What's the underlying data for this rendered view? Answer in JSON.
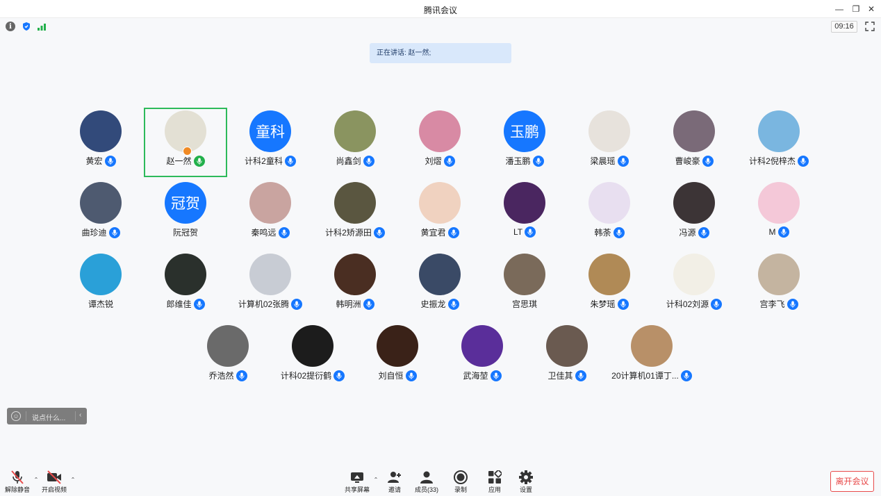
{
  "window": {
    "title": "腾讯会议"
  },
  "status": {
    "time": "09:16"
  },
  "speaking": {
    "text": "正在讲话: 赵一然;"
  },
  "colors": {
    "accent": "#1677ff",
    "active_border": "#2dba5a",
    "leave": "#e84a4a"
  },
  "participants": [
    {
      "name": "黄宏",
      "avatar_text": "",
      "bg": "#324a7a"
    },
    {
      "name": "赵一然",
      "avatar_text": "",
      "bg": "#e3e0d4",
      "active": true,
      "host": true,
      "mic": "on"
    },
    {
      "name": "计科2童科",
      "avatar_text": "童科",
      "bg": "#1677ff"
    },
    {
      "name": "尚鑫剑",
      "avatar_text": "",
      "bg": "#8a9460"
    },
    {
      "name": "刘熠",
      "avatar_text": "",
      "bg": "#d88aa4"
    },
    {
      "name": "潘玉鹏",
      "avatar_text": "玉鹏",
      "bg": "#1677ff"
    },
    {
      "name": "梁晨瑶",
      "avatar_text": "",
      "bg": "#e7e2dc"
    },
    {
      "name": "曹峻豪",
      "avatar_text": "",
      "bg": "#7a6a78"
    },
    {
      "name": "计科2倪梓杰",
      "avatar_text": "",
      "bg": "#7ab6e0"
    },
    {
      "name": "曲珍迪",
      "avatar_text": "",
      "bg": "#4e5a70"
    },
    {
      "name": "阮冠贺",
      "avatar_text": "冠贺",
      "bg": "#1677ff",
      "no_mic": true
    },
    {
      "name": "秦鸣远",
      "avatar_text": "",
      "bg": "#c9a4a0"
    },
    {
      "name": "计科2矫源田",
      "avatar_text": "",
      "bg": "#5a5640"
    },
    {
      "name": "黄宜君",
      "avatar_text": "",
      "bg": "#f0d2c0"
    },
    {
      "name": "LT",
      "avatar_text": "",
      "bg": "#4a2660"
    },
    {
      "name": "韩荼",
      "avatar_text": "",
      "bg": "#e8dff0"
    },
    {
      "name": "冯源",
      "avatar_text": "",
      "bg": "#3c3436"
    },
    {
      "name": "M",
      "avatar_text": "",
      "bg": "#f4c8d8"
    },
    {
      "name": "谭杰锐",
      "avatar_text": "",
      "bg": "#2aa0d8",
      "no_mic": true
    },
    {
      "name": "郎维佳",
      "avatar_text": "",
      "bg": "#2a302c"
    },
    {
      "name": "计算机02张腾",
      "avatar_text": "",
      "bg": "#c8ccd4"
    },
    {
      "name": "韩明洲",
      "avatar_text": "",
      "bg": "#4a2e22"
    },
    {
      "name": "史振龙",
      "avatar_text": "",
      "bg": "#3a4a66"
    },
    {
      "name": "宫思琪",
      "avatar_text": "",
      "bg": "#7a6a5a",
      "no_mic": true
    },
    {
      "name": "朱梦瑶",
      "avatar_text": "",
      "bg": "#b08a56"
    },
    {
      "name": "计科02刘源",
      "avatar_text": "",
      "bg": "#f2efe6"
    },
    {
      "name": "宫李飞",
      "avatar_text": "",
      "bg": "#c4b4a0"
    },
    {
      "name": "乔浩然",
      "avatar_text": "",
      "bg": "#6a6a6a"
    },
    {
      "name": "计科02提衍鹤",
      "avatar_text": "",
      "bg": "#1c1c1c"
    },
    {
      "name": "刘自恒",
      "avatar_text": "",
      "bg": "#3a2218"
    },
    {
      "name": "武海堃",
      "avatar_text": "",
      "bg": "#5a2e9a"
    },
    {
      "name": "卫佳其",
      "avatar_text": "",
      "bg": "#6a5a50"
    },
    {
      "name": "20计算机01谭丁...",
      "avatar_text": "",
      "bg": "#b89068"
    }
  ],
  "chat": {
    "placeholder": "说点什么..."
  },
  "toolbar": {
    "unmute": "解除静音",
    "start_video": "开启视频",
    "share": "共享屏幕",
    "invite": "邀请",
    "members": "成员(33)",
    "record": "录制",
    "apps": "应用",
    "settings": "设置",
    "leave": "离开会议"
  }
}
